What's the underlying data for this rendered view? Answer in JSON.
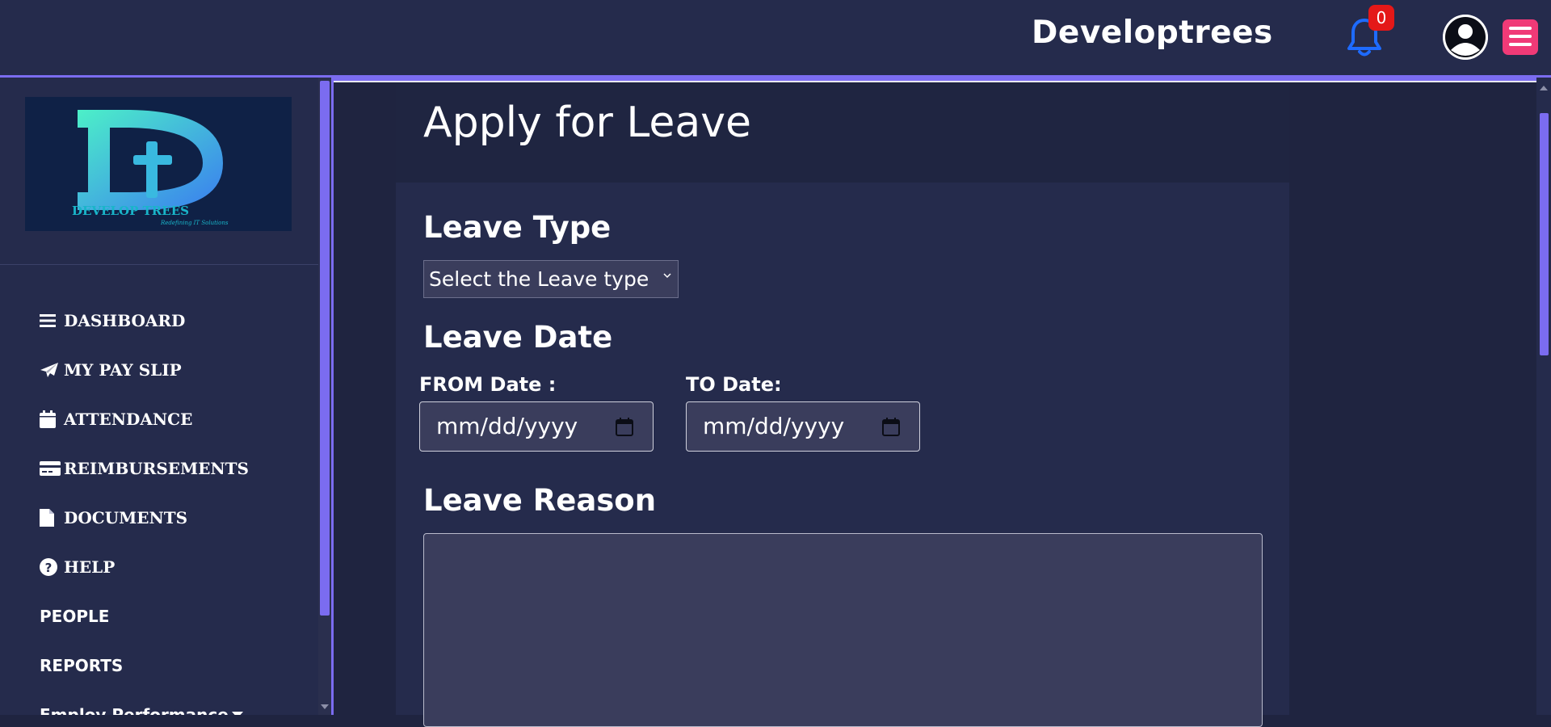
{
  "header": {
    "title": "Developtrees",
    "notification_count": "0",
    "icons": [
      "bell-icon",
      "user-avatar-icon",
      "menu-icon"
    ]
  },
  "logo": {
    "wordmark": "DEVELOP TREES",
    "tagline": "Redefining IT Solutions"
  },
  "sidebar": {
    "items": [
      {
        "label": "DASHBOARD",
        "icon": "bars-icon"
      },
      {
        "label": "MY PAY SLIP",
        "icon": "paper-plane-icon"
      },
      {
        "label": "ATTENDANCE",
        "icon": "calendar-icon"
      },
      {
        "label": "REIMBURSEMENTS",
        "icon": "credit-card-icon"
      },
      {
        "label": "DOCUMENTS",
        "icon": "file-icon"
      },
      {
        "label": "HELP",
        "icon": "question-circle-icon"
      },
      {
        "label": "PEOPLE"
      },
      {
        "label": "REPORTS"
      },
      {
        "label": "Employ Performance"
      }
    ]
  },
  "form": {
    "title": "Apply for Leave",
    "leave_type_label": "Leave Type",
    "leave_type_value": "Select the Leave type",
    "leave_date_label": "Leave Date",
    "from_label": "FROM Date :",
    "to_label": "TO Date:",
    "from_placeholder": "mm/dd/yyyy",
    "to_placeholder": "mm/dd/yyyy",
    "reason_label": "Leave Reason",
    "reason_value": ""
  },
  "colors": {
    "accent": "#7b6cf0",
    "topbar_bg": "#252b4c",
    "badge": "#e41818",
    "menu_button": "#f03a77",
    "bell": "#1e6bff"
  }
}
